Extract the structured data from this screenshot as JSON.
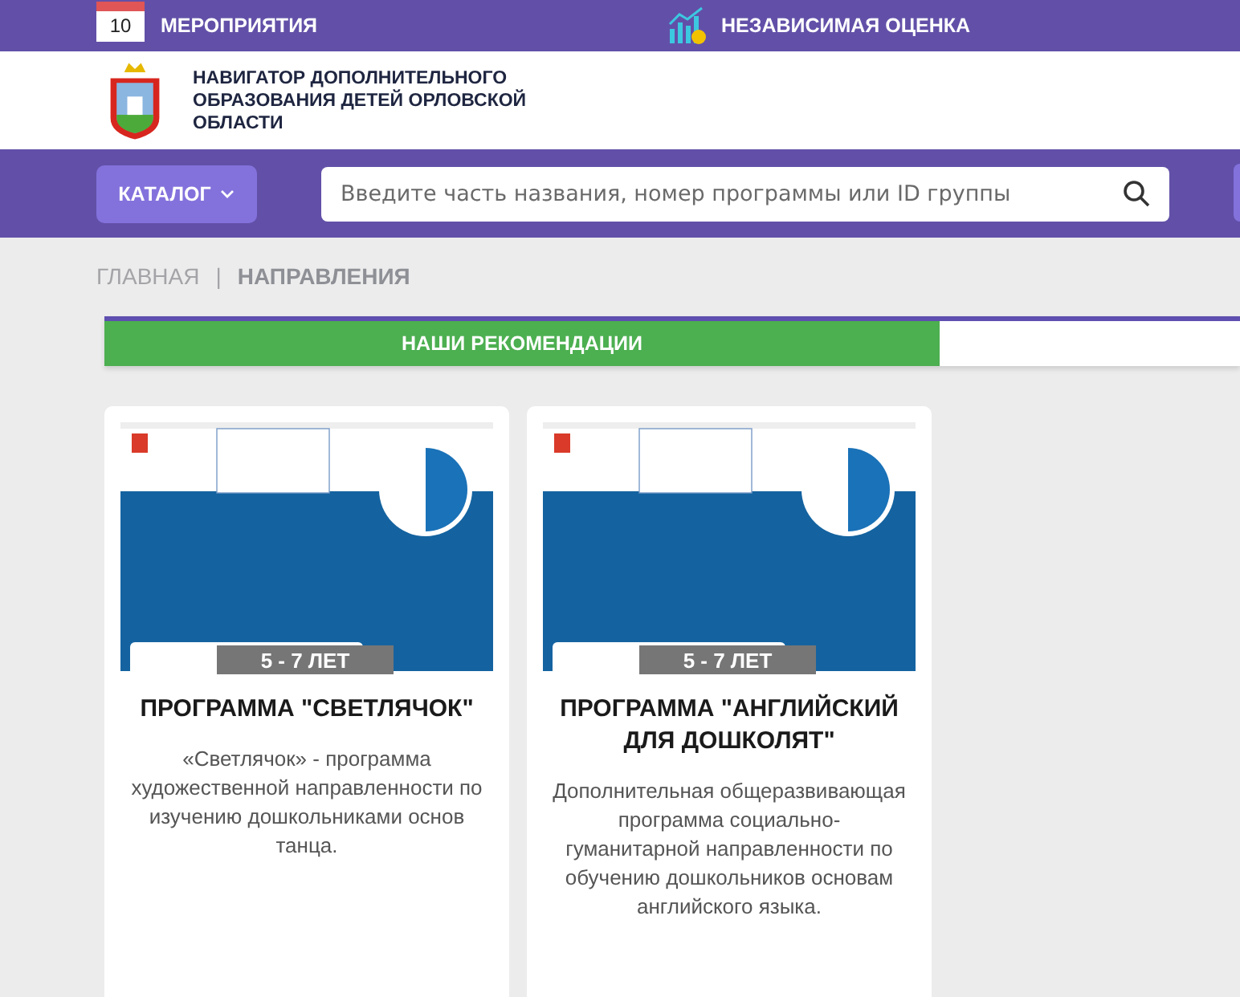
{
  "top_bar": {
    "calendar_day": "10",
    "links": [
      {
        "kind": "events",
        "label": "МЕРОПРИЯТИЯ"
      },
      {
        "kind": "rating",
        "label": "НЕЗАВИСИМАЯ ОЦЕНКА"
      }
    ]
  },
  "header": {
    "title": "НАВИГАТОР ДОПОЛНИТЕЛЬНОГО ОБРАЗОВАНИЯ ДЕТЕЙ ОРЛОВСКОЙ ОБЛАСТИ"
  },
  "search_bar": {
    "catalog_button": "КАТАЛОГ",
    "placeholder": "Введите часть названия, номер программы или ID группы"
  },
  "breadcrumbs": [
    {
      "label": "ГЛАВНАЯ",
      "selected": false
    },
    {
      "label": "НАПРАВЛЕНИЯ",
      "selected": true
    }
  ],
  "breadcrumb_separator": "|",
  "tabs": [
    {
      "label": "НАШИ РЕКОМЕНДАЦИИ",
      "selected": true
    },
    {
      "selected": false
    }
  ],
  "cards": [
    {
      "age": "5 - 7 ЛЕТ",
      "title": "ПРОГРАММА \"СВЕТЛЯЧОК\"",
      "description": "«Светлячок» - программа художественной направленности по изучению дошкольниками основ танца."
    },
    {
      "age": "5 - 7 ЛЕТ",
      "title": "ПРОГРАММА \"АНГЛИЙСКИЙ ДЛЯ ДОШКОЛЯТ\"",
      "description": "Дополнительная общеразвивающая программа социально-гуманитарной направленности по обучению дошкольников основам английского языка."
    }
  ]
}
